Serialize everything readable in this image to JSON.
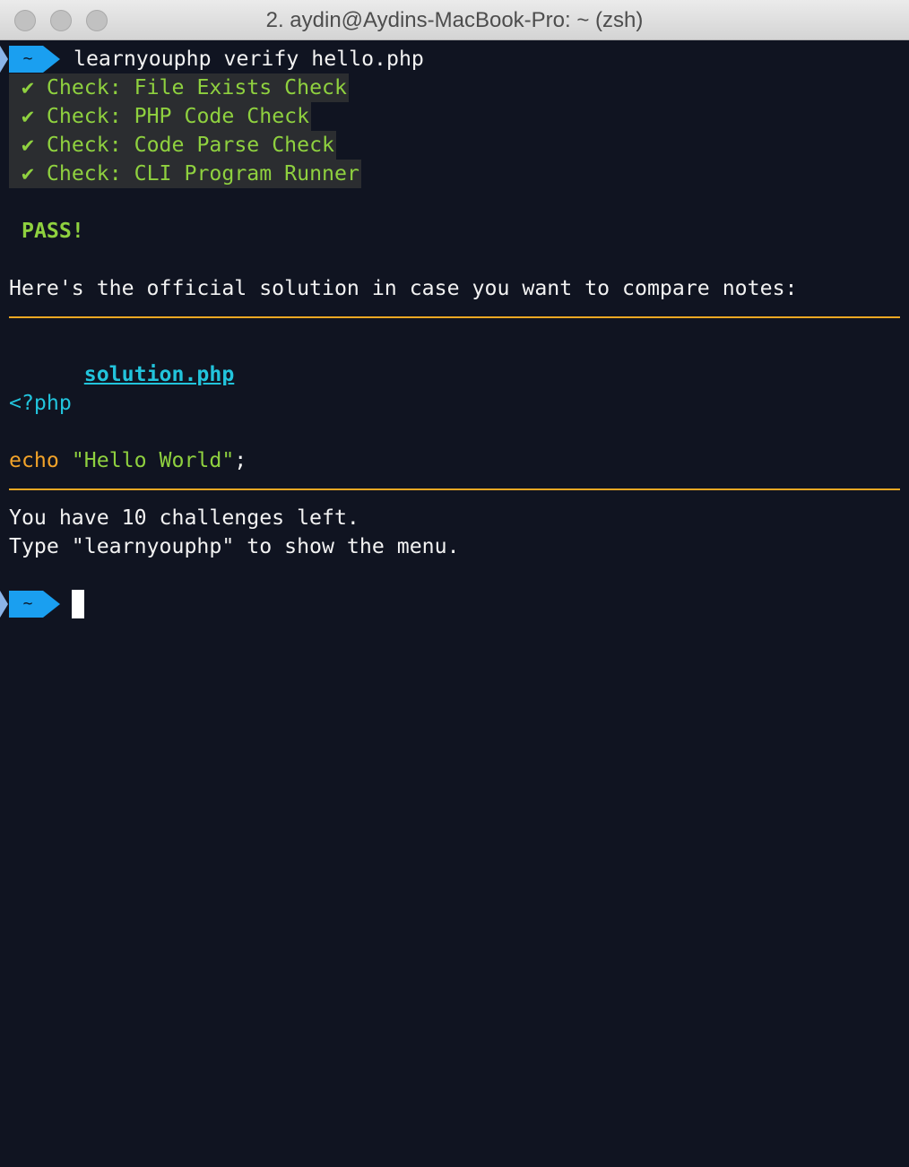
{
  "window": {
    "title": "2. aydin@Aydins-MacBook-Pro: ~ (zsh)"
  },
  "prompt": {
    "dir": "~",
    "command": "learnyouphp verify hello.php"
  },
  "checks": [
    "✔ Check: File Exists Check",
    "✔ Check: PHP Code Check",
    "✔ Check: Code Parse Check",
    "✔ Check: CLI Program Runner"
  ],
  "result": "PASS!",
  "solution_intro": "Here's the official solution in case you want to compare notes:",
  "solution": {
    "filename": "solution.php",
    "code": {
      "open_tag": "<?php",
      "keyword": "echo",
      "string": "\"Hello World\"",
      "terminator": ";"
    }
  },
  "footer": {
    "remaining": "You have 10 challenges left.",
    "hint": "Type \"learnyouphp\" to show the menu."
  },
  "prompt2": {
    "dir": "~"
  },
  "colors": {
    "background": "#101421",
    "prompt_blue": "#1a9ff0",
    "success_green": "#8fd13f",
    "rule_orange": "#f0a823",
    "link_cyan": "#22c4dc"
  }
}
